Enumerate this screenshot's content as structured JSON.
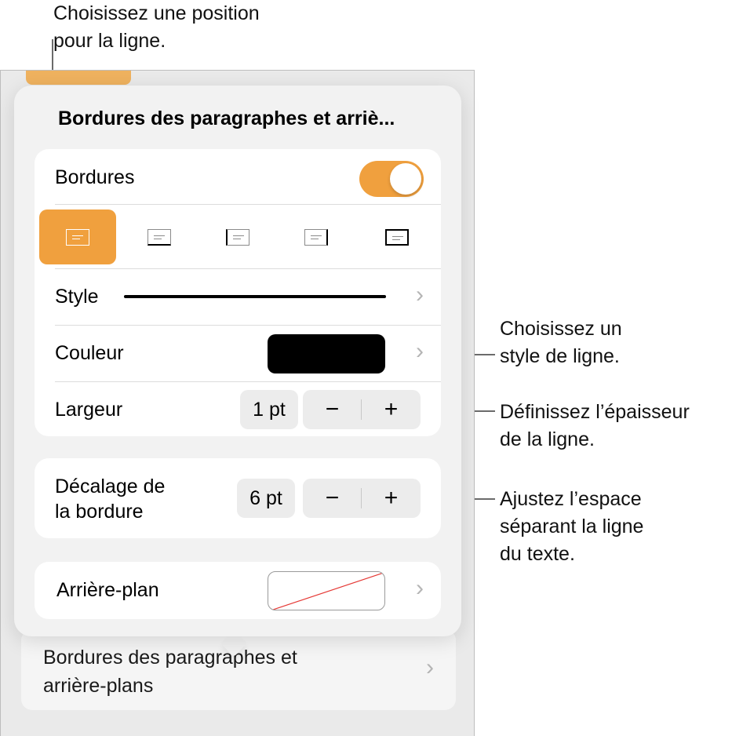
{
  "callouts": {
    "position": [
      "Choisissez une position",
      "pour la ligne."
    ],
    "style": [
      "Choisissez un",
      "style de ligne."
    ],
    "width": [
      "Définissez l’épaisseur",
      "de la ligne."
    ],
    "offset": [
      "Ajustez l’espace",
      "séparant la ligne",
      "du texte."
    ]
  },
  "popover": {
    "title": "Bordures des paragraphes et arriè...",
    "borders": {
      "label": "Bordures",
      "toggle_on": true,
      "positions": [
        {
          "name": "paragraph-border-top",
          "selected": true
        },
        {
          "name": "paragraph-border-bottom",
          "selected": false
        },
        {
          "name": "paragraph-border-left",
          "selected": false
        },
        {
          "name": "paragraph-border-right",
          "selected": false
        },
        {
          "name": "paragraph-border-box",
          "selected": false
        }
      ]
    },
    "style": {
      "label": "Style"
    },
    "color": {
      "label": "Couleur",
      "value": "#000000"
    },
    "width": {
      "label": "Largeur",
      "value": "1 pt",
      "minus": "−",
      "plus": "+"
    },
    "offset": {
      "label_line1": "Décalage de",
      "label_line2": "la bordure",
      "value": "6 pt",
      "minus": "−",
      "plus": "+"
    },
    "background": {
      "label": "Arrière-plan"
    }
  },
  "underlying": {
    "row_line1": "Bordures des paragraphes et",
    "row_line2": "arrière-plans"
  },
  "colors": {
    "accent": "#f0a03e",
    "swatch_none_line": "#e53935"
  },
  "icons": {
    "chevron": "chevron-right-icon"
  }
}
